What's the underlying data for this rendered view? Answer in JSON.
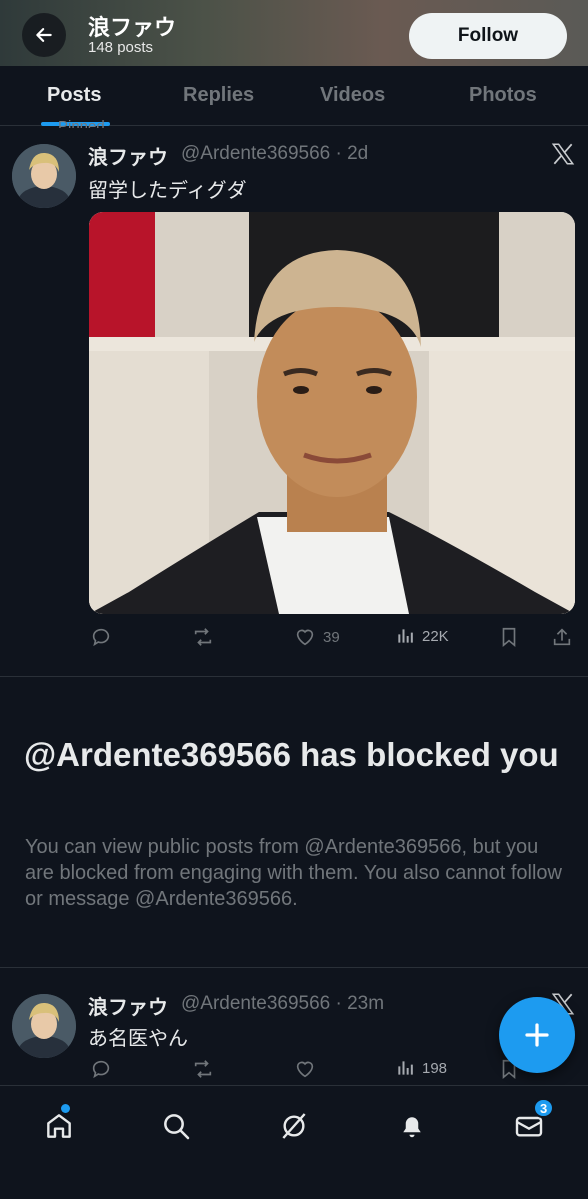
{
  "header": {
    "title": "浪ファウ",
    "post_count": "148 posts",
    "follow_label": "Follow"
  },
  "tabs": [
    {
      "label": "Posts",
      "active": true
    },
    {
      "label": "Replies",
      "active": false
    },
    {
      "label": "Videos",
      "active": false
    },
    {
      "label": "Photos",
      "active": false
    }
  ],
  "pinned_label": "Pinned",
  "posts": [
    {
      "name": "浪ファウ",
      "handle_time": "@Ardente369566 · 2d",
      "text": "留学したディグダ",
      "stats": {
        "likes": "39",
        "views": "22K"
      }
    },
    {
      "name": "浪ファウ",
      "handle_time": "@Ardente369566 · 23m",
      "text": "あ名医やん",
      "stats": {
        "likes": "",
        "views": "198"
      }
    }
  ],
  "blocked": {
    "title": "@Ardente369566 has blocked you",
    "body": "You can view public posts from @Ardente369566, but you are blocked from engaging with them. You also cannot follow or message @Ardente369566."
  },
  "nav": {
    "messages_badge": "3"
  },
  "colors": {
    "accent": "#1d9bf0",
    "background": "#0f141d",
    "muted": "#71767b"
  },
  "icons": [
    "back-arrow-icon",
    "x-logo-icon",
    "reply-icon",
    "repost-icon",
    "like-icon",
    "views-icon",
    "bookmark-icon",
    "share-icon",
    "plus-icon",
    "home-icon",
    "search-icon",
    "grok-icon",
    "bell-icon",
    "mail-icon"
  ]
}
